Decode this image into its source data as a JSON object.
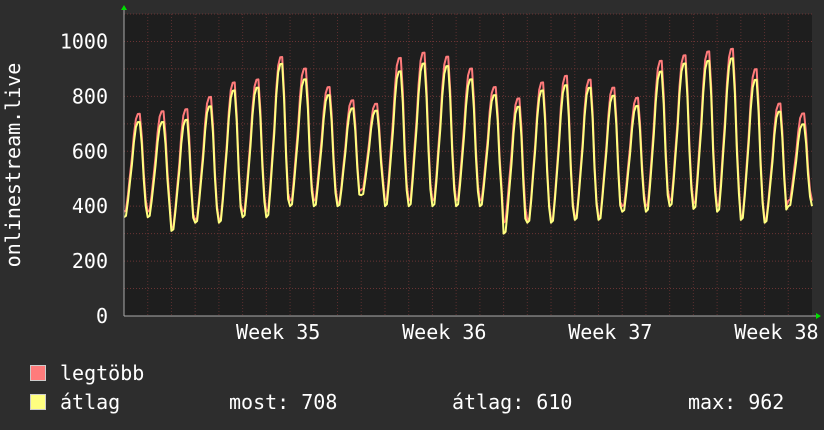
{
  "chart_data": {
    "type": "line",
    "ylabel": "onlinestream.live",
    "ylim": [
      0,
      1100
    ],
    "yticks": [
      0,
      200,
      400,
      600,
      800,
      1000
    ],
    "x_ticks": [
      "Week 35",
      "Week 36",
      "Week 37",
      "Week 38"
    ],
    "n_days": 29,
    "colors": {
      "background": "#2d2d2d",
      "plot": "#1e1e1e",
      "grid": "#6a3434",
      "axis": "#aaaaaa",
      "max": "#ff7b7b",
      "avg": "#ffff80",
      "arrow": "#00dd00"
    },
    "series": [
      {
        "name": "legtöbb",
        "peaks": [
          750,
          760,
          770,
          815,
          870,
          880,
          965,
          920,
          850,
          800,
          785,
          960,
          980,
          965,
          920,
          850,
          810,
          870,
          895,
          880,
          850,
          810,
          950,
          970,
          985,
          995,
          920,
          790,
          750
        ],
        "troughs": [
          380,
          380,
          320,
          350,
          350,
          380,
          380,
          420,
          420,
          410,
          460,
          420,
          420,
          420,
          420,
          420,
          340,
          350,
          350,
          360,
          360,
          400,
          400,
          420,
          410,
          400,
          360,
          350,
          420
        ]
      },
      {
        "name": "átlag",
        "peaks": [
          720,
          720,
          730,
          780,
          840,
          850,
          940,
          880,
          820,
          770,
          760,
          910,
          940,
          930,
          880,
          820,
          780,
          840,
          860,
          850,
          820,
          780,
          910,
          940,
          950,
          960,
          880,
          760,
          710
        ],
        "troughs": [
          360,
          360,
          310,
          340,
          340,
          360,
          360,
          400,
          400,
          400,
          440,
          400,
          400,
          400,
          400,
          400,
          300,
          340,
          340,
          350,
          350,
          380,
          380,
          400,
          390,
          380,
          350,
          340,
          400
        ]
      }
    ]
  },
  "legend": {
    "max_label": "legtöbb",
    "avg_label": "átlag"
  },
  "stats": {
    "current": "most: 708",
    "average": "átlag: 610",
    "maximum": "max: 962"
  }
}
